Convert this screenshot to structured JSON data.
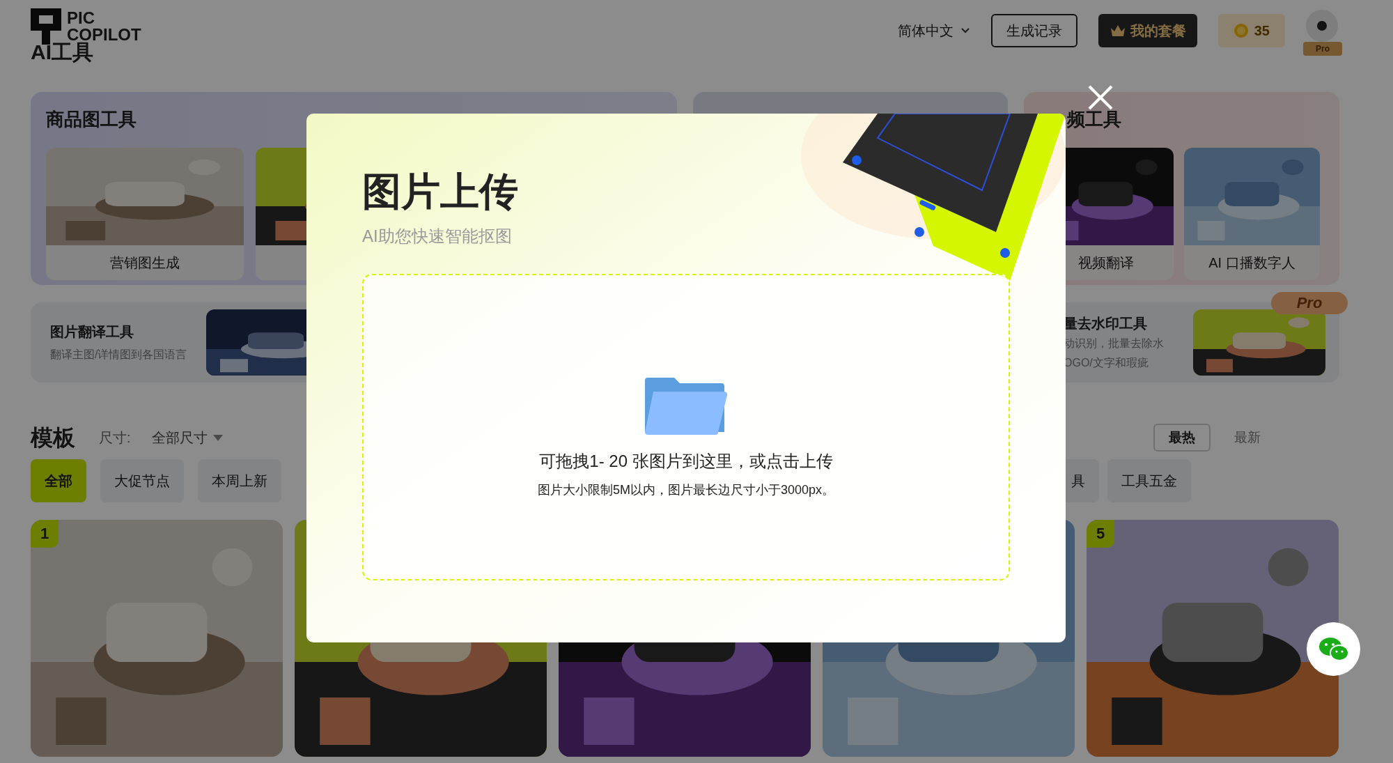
{
  "header": {
    "logo_lines": [
      "PIC",
      "COPILOT"
    ],
    "page_title": "AI工具",
    "language": "简体中文",
    "history_button": "生成记录",
    "plan_button": "我的套餐",
    "credits": "35",
    "avatar_badge": "Pro"
  },
  "tool_groups": [
    {
      "title": "商品图工具",
      "items": [
        {
          "label": "营销图生成"
        },
        {
          "kind": "picture"
        }
      ]
    },
    {
      "kind": "panel"
    },
    {
      "title": "频工具",
      "items": [
        {
          "label": "视频翻译"
        },
        {
          "label": "AI 口播数字人"
        }
      ]
    }
  ],
  "feature_cards": [
    {
      "title": "图片翻译工具",
      "description": "翻译主图/详情图到各国语言"
    },
    {
      "title": "量去水印工具",
      "description_lines": [
        "动识别，批量去除水",
        "OGO/文字和瑕疵"
      ],
      "badge": "Pro"
    }
  ],
  "templates": {
    "title": "模板",
    "size_label": "尺寸:",
    "size_value": "全部尺寸",
    "sort": [
      {
        "label": "最热",
        "selected": true
      },
      {
        "label": "最新",
        "selected": false
      }
    ],
    "categories_left": [
      {
        "label": "全部",
        "selected": true
      },
      {
        "label": "大促节点",
        "selected": false
      },
      {
        "label": "本周上新",
        "selected": false
      }
    ],
    "categories_right": [
      {
        "label": "具",
        "selected": false
      },
      {
        "label": "工具五金",
        "selected": false
      }
    ],
    "cards": [
      {
        "kind": "picture",
        "rank": "1"
      },
      {
        "kind": "picture"
      },
      {
        "kind": "picture"
      },
      {
        "kind": "picture"
      },
      {
        "kind": "picture",
        "rank": "5"
      }
    ]
  },
  "modal": {
    "title": "图片上传",
    "subtitle": "AI助您快速智能抠图",
    "dropzone": {
      "instruction": "可拖拽1- 20 张图片到这里，或点击上传",
      "limits": "图片大小限制5M以内，图片最长边尺寸小于3000px。"
    }
  }
}
